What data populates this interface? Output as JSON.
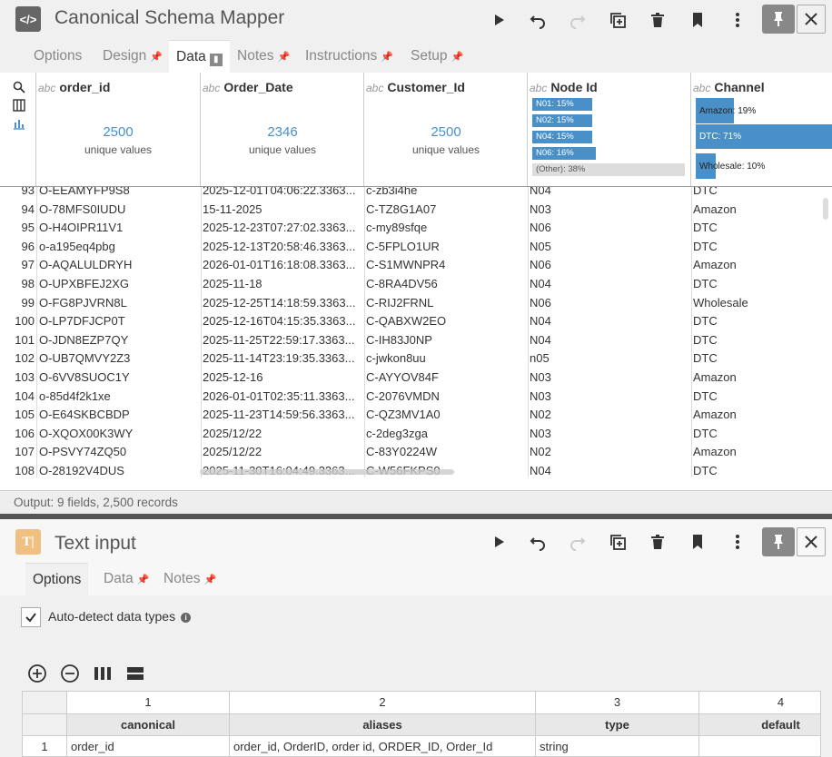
{
  "panel1": {
    "title": "Canonical Schema Mapper",
    "icon": "</>",
    "tabs": [
      {
        "label": "Options",
        "pinned": false
      },
      {
        "label": "Design",
        "pinned": true
      },
      {
        "label": "Data",
        "pinned": true,
        "active": true
      },
      {
        "label": "Notes",
        "pinned": true
      },
      {
        "label": "Instructions",
        "pinned": true
      },
      {
        "label": "Setup",
        "pinned": true
      }
    ],
    "columns": [
      {
        "type": "abc",
        "name": "order_id",
        "unique_count": "2500",
        "unique_label": "unique values"
      },
      {
        "type": "abc",
        "name": "Order_Date",
        "unique_count": "2346",
        "unique_label": "unique values"
      },
      {
        "type": "abc",
        "name": "Customer_Id",
        "unique_count": "2500",
        "unique_label": "unique values"
      },
      {
        "type": "abc",
        "name": "Node Id",
        "bars": [
          {
            "label": "N01: 15%",
            "pct": 15
          },
          {
            "label": "N02: 15%",
            "pct": 15
          },
          {
            "label": "N04: 15%",
            "pct": 15
          },
          {
            "label": "N06: 16%",
            "pct": 16
          },
          {
            "label": "(Other): 38%",
            "pct": 38,
            "other": true
          }
        ]
      },
      {
        "type": "abc",
        "name": "Channel",
        "bars": [
          {
            "label": "Amazon: 19%",
            "pct": 19
          },
          {
            "label": "DTC: 71%",
            "pct": 71
          },
          {
            "label": "Wholesale: 10%",
            "pct": 10
          }
        ]
      }
    ],
    "rows": [
      [
        "93",
        "O-EEAMYFP9S8",
        "2025-12-01T04:06:22.3363...",
        "c-zb3i4he",
        "N04",
        "DTC"
      ],
      [
        "94",
        "O-78MFS0IUDU",
        "15-11-2025",
        "C-TZ8G1A07",
        "N03",
        "Amazon"
      ],
      [
        "95",
        "O-H4OIPR11V1",
        "2025-12-23T07:27:02.3363...",
        "c-my89sfqe",
        "N06",
        "DTC"
      ],
      [
        "96",
        "o-a195eq4pbg",
        "2025-12-13T20:58:46.3363...",
        "C-5FPLO1UR",
        "N05",
        "DTC"
      ],
      [
        "97",
        "O-AQALULDRYH",
        "2026-01-01T16:18:08.3363...",
        "C-S1MWNPR4",
        "N06",
        "Amazon"
      ],
      [
        "98",
        "O-UPXBFEJ2XG",
        "2025-11-18",
        "C-8RA4DV56",
        "N04",
        "DTC"
      ],
      [
        "99",
        "O-FG8PJVRN8L",
        "2025-12-25T14:18:59.3363...",
        "C-RIJ2FRNL",
        "N06",
        "Wholesale"
      ],
      [
        "100",
        "O-LP7DFJCP0T",
        "2025-12-16T04:15:35.3363...",
        "C-QABXW2EO",
        "N04",
        "DTC"
      ],
      [
        "101",
        "O-JDN8EZP7QY",
        "2025-11-25T22:59:17.3363...",
        "C-IH83J0NP",
        "N04",
        "DTC"
      ],
      [
        "102",
        "O-UB7QMVY2Z3",
        "2025-11-14T23:19:35.3363...",
        "c-jwkon8uu",
        "n05",
        "DTC"
      ],
      [
        "103",
        "O-6VV8SUOC1Y",
        "2025-12-16",
        "C-AYYOV84F",
        "N03",
        "Amazon"
      ],
      [
        "104",
        "o-85d4f2k1xe",
        "2026-01-01T02:35:11.3363...",
        "C-2076VMDN",
        "N03",
        "DTC"
      ],
      [
        "105",
        "O-E64SKBCBDP",
        "2025-11-23T14:59:56.3363...",
        "C-QZ3MV1A0",
        "N02",
        "Amazon"
      ],
      [
        "106",
        "O-XQOX00K3WY",
        "2025/12/22",
        "c-2deg3zga",
        "N03",
        "DTC"
      ],
      [
        "107",
        "O-PSVY74ZQ50",
        "2025/12/22",
        "C-83Y0224W",
        "N02",
        "Amazon"
      ],
      [
        "108",
        "O-28192V4DUS",
        "2025-11-30T16:04:49.3363...",
        "C-W56FKPS0",
        "N04",
        "DTC"
      ]
    ],
    "status": "Output: 9 fields, 2,500 records"
  },
  "panel2": {
    "title": "Text input",
    "icon": "T|",
    "tabs": [
      {
        "label": "Options",
        "pinned": false,
        "active": true
      },
      {
        "label": "Data",
        "pinned": true
      },
      {
        "label": "Notes",
        "pinned": true
      }
    ],
    "autodetect_label": "Auto-detect data types",
    "autodetect_checked": true,
    "table": {
      "col_numbers": [
        "1",
        "2",
        "3",
        "4"
      ],
      "headers": [
        "canonical",
        "aliases",
        "type",
        "default"
      ],
      "rows": [
        [
          "1",
          "order_id",
          "order_id, OrderID, order id, ORDER_ID, Order_Id",
          "string",
          ""
        ]
      ]
    }
  },
  "colors": {
    "accent": "#4a90c8",
    "code_icon_bg": "#666666",
    "text_icon_bg": "#f0c080"
  }
}
